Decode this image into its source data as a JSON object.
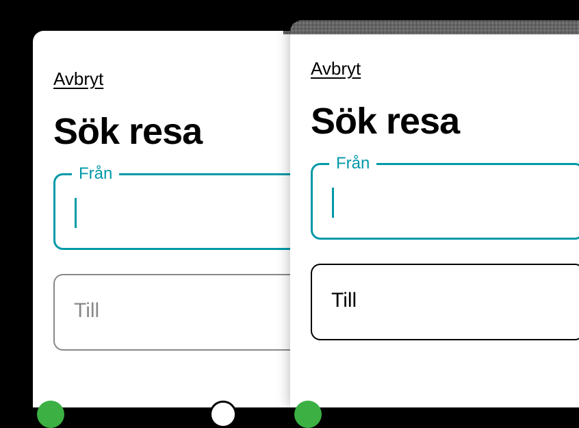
{
  "left_panel": {
    "cancel_label": "Avbryt",
    "title": "Sök resa",
    "from_label": "Från",
    "from_value": "",
    "to_placeholder": "Till"
  },
  "right_panel": {
    "cancel_label": "Avbryt",
    "title": "Sök resa",
    "from_label": "Från",
    "from_value": "",
    "to_placeholder": "Till"
  },
  "colors": {
    "focus": "#0099a8",
    "accent_green": "#3cb043"
  }
}
